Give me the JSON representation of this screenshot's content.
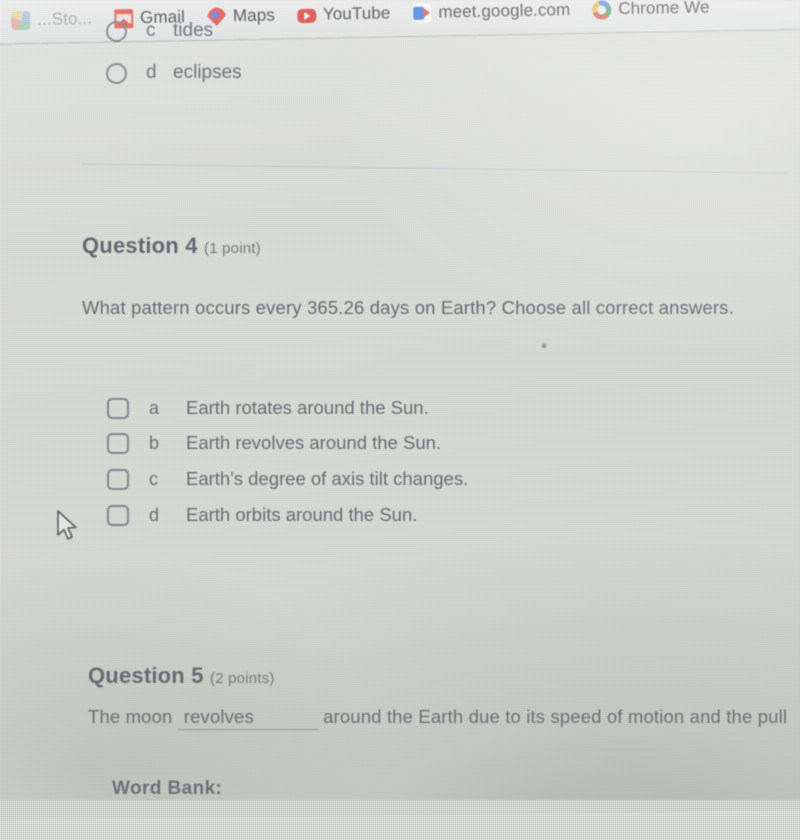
{
  "browser": {
    "bookmarks": [
      {
        "label": "...Sto...",
        "icon": "chrome-web-store-icon",
        "truncated": true
      },
      {
        "label": "Gmail",
        "icon": "gmail-icon"
      },
      {
        "label": "Maps",
        "icon": "maps-pin-icon"
      },
      {
        "label": "YouTube",
        "icon": "youtube-icon"
      },
      {
        "label": "meet.google.com",
        "icon": "google-meet-icon"
      },
      {
        "label": "Chrome We",
        "icon": "chrome-web-store-icon",
        "truncated": true
      }
    ]
  },
  "previous_question_options": [
    {
      "letter": "c",
      "text": "tides",
      "control": "radio",
      "checked": false
    },
    {
      "letter": "d",
      "text": "eclipses",
      "control": "radio",
      "checked": false
    }
  ],
  "question4": {
    "heading": "Question 4",
    "points": "(1 point)",
    "prompt": "What pattern occurs every 365.26 days on Earth?  Choose all correct answers.",
    "choices": [
      {
        "letter": "a",
        "text": "Earth rotates around the Sun.",
        "checked": false
      },
      {
        "letter": "b",
        "text": "Earth revolves around the Sun.",
        "checked": false
      },
      {
        "letter": "c",
        "text": "Earth's degree of axis tilt changes.",
        "checked": false
      },
      {
        "letter": "d",
        "text": "Earth orbits around the Sun.",
        "checked": false
      }
    ]
  },
  "question5": {
    "heading": "Question 5",
    "points": "(2 points)",
    "text_before": "The moon",
    "blank_value": "revolves",
    "text_after": "around the Earth due to its speed of motion and the pull",
    "word_bank_label": "Word Bank:"
  },
  "colors": {
    "page_background": "#d8dad3",
    "text": "#4a525d",
    "heading": "#454e5a",
    "divider": "#b9bcd4",
    "checkbox_border": "#6a7384",
    "bookmark_bar": "#eceded"
  }
}
